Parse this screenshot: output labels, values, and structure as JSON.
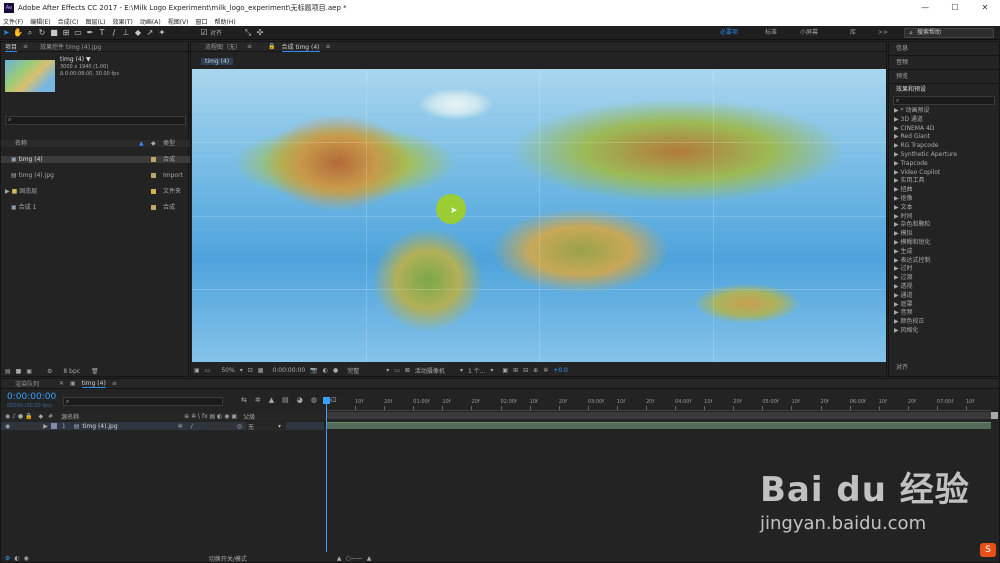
{
  "window": {
    "title": "Adobe After Effects CC 2017 - E:\\Milk Logo Experiment\\milk_logo_experiment\\无标题项目.aep *",
    "app_icon": "Ae"
  },
  "menu": [
    "文件(F)",
    "编辑(E)",
    "合成(C)",
    "图层(L)",
    "效果(T)",
    "动画(A)",
    "视图(V)",
    "窗口",
    "帮助(H)"
  ],
  "toolbar": {
    "align_label": "对齐",
    "workspaces": [
      "必要项",
      "标准",
      "小屏幕",
      "库"
    ],
    "search_placeholder": "搜索帮助",
    "workspace_arrow": ">>"
  },
  "project": {
    "tab": "项目",
    "effects_tab": "效果控件 timg (4).jpg",
    "item_name": "timg (4) ▼",
    "item_info1": "3000 x 1940 (1.00)",
    "item_info2": "Δ 0:00:08:00, 30.00 fps",
    "col_name": "名称",
    "col_type": "类型",
    "items": [
      {
        "name": "timg (4)",
        "type": "合成"
      },
      {
        "name": "timg (4).jpg",
        "type": "Import"
      },
      {
        "name": "固态层",
        "type": "文件夹"
      },
      {
        "name": "合成 1",
        "type": "合成"
      }
    ],
    "bpc": "8 bpc"
  },
  "viewer": {
    "flow_tab": "流程图（无）",
    "comp_tab": "合成 timg (4)",
    "sub_tab": "timg (4)",
    "zoom": "50%",
    "timecode": "0:00:00:00",
    "quality": "完整",
    "camera": "活动摄像机",
    "views": "1 个...",
    "exposure": "+0.0"
  },
  "right_panel": {
    "info": "信息",
    "audio": "音频",
    "preview": "预览",
    "effects_title": "效果和预设",
    "align": "对齐",
    "effects": [
      "* 动画预设",
      "3D 通道",
      "CINEMA 4D",
      "Red Giant",
      "RG Trapcode",
      "Synthetic Aperture",
      "Trapcode",
      "Video Copilot",
      "实用工具",
      "扭曲",
      "抠像",
      "文本",
      "时间",
      "杂色和颗粒",
      "模拟",
      "模糊和锐化",
      "生成",
      "表达式控制",
      "过时",
      "过渡",
      "透视",
      "通道",
      "遮罩",
      "音频",
      "颜色校正",
      "风格化"
    ]
  },
  "timeline": {
    "render_tab": "渲染队列",
    "comp_tab": "timg (4)",
    "timecode": "0:00:00:00",
    "frame_info": "00000 (30.00 fps)",
    "col_source": "源名称",
    "col_parent": "父级",
    "layer_num": "1",
    "layer_name": "timg (4).jpg",
    "parent_value": "无",
    "switch_label": "切换开关/模式",
    "ruler": [
      "0f",
      "10f",
      "20f",
      "01:00f",
      "10f",
      "20f",
      "02:00f",
      "10f",
      "20f",
      "03:00f",
      "10f",
      "20f",
      "04:00f",
      "10f",
      "20f",
      "05:00f",
      "10f",
      "20f",
      "06:00f",
      "10f",
      "20f",
      "07:00f",
      "10f"
    ]
  },
  "watermark": {
    "logo": "Bai du 经验",
    "url": "jingyan.baidu.com"
  },
  "colors": {
    "accent": "#2d8ceb",
    "timecode": "#3aa0ff",
    "cursor": "#a0d020",
    "layer_bar": "#556a5a"
  }
}
